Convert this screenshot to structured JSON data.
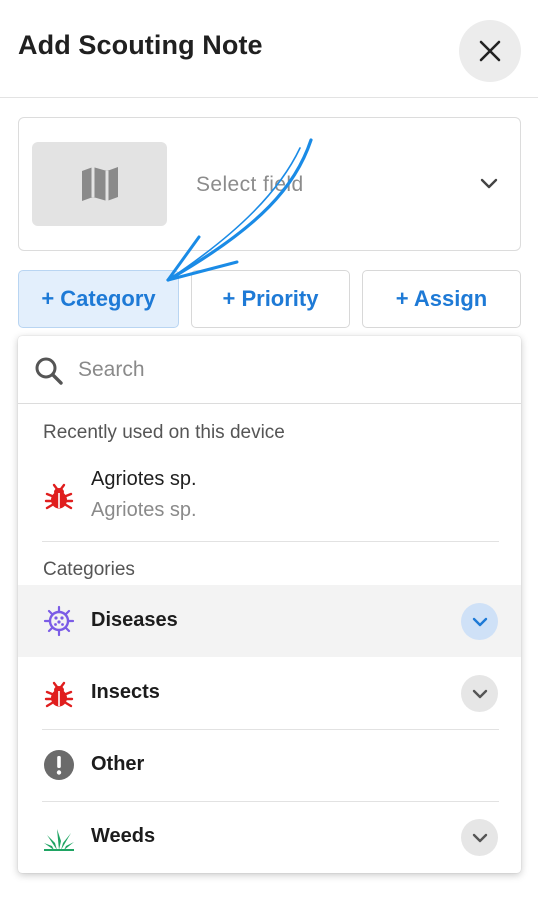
{
  "header": {
    "title": "Add Scouting Note",
    "close_icon": "close-icon"
  },
  "field_selector": {
    "placeholder": "Select field",
    "thumbnail_icon": "map-icon",
    "chevron_icon": "chevron-down-icon"
  },
  "chips": [
    {
      "label": "+ Category",
      "active": true
    },
    {
      "label": "+ Priority",
      "active": false
    },
    {
      "label": "+ Assign",
      "active": false
    }
  ],
  "dropdown": {
    "search": {
      "placeholder": "Search",
      "value": "",
      "icon": "search-icon"
    },
    "recent_label": "Recently used on this device",
    "recent_items": [
      {
        "title": "Agriotes sp.",
        "subtitle": "Agriotes sp.",
        "icon": "bug-icon"
      }
    ],
    "categories_label": "Categories",
    "categories": [
      {
        "label": "Diseases",
        "icon": "virus-icon",
        "expandable": true,
        "highlighted": true
      },
      {
        "label": "Insects",
        "icon": "bug-icon",
        "expandable": true,
        "highlighted": false
      },
      {
        "label": "Other",
        "icon": "exclamation-icon",
        "expandable": false,
        "highlighted": false
      },
      {
        "label": "Weeds",
        "icon": "grass-icon",
        "expandable": true,
        "highlighted": false
      }
    ]
  },
  "colors": {
    "accent": "#1e7ad6",
    "chip_active_bg": "#e3effc",
    "bug": "#e01e1e",
    "virus": "#7b5ce6",
    "other": "#6b6b6b",
    "weeds": "#1fa463",
    "annotation_arrow": "#1a8be6"
  }
}
